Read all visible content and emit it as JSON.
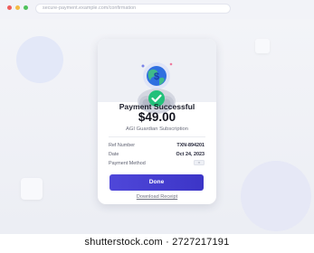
{
  "browser": {
    "url": "secure-payment.example.com/confirmation"
  },
  "receipt": {
    "title": "Payment Successful",
    "amount": "$49.00",
    "product": "AGI Guardian Subscription",
    "details": [
      {
        "label": "Ref Number",
        "value": "TXN-894201"
      },
      {
        "label": "Date",
        "value": "Oct 24, 2023"
      },
      {
        "label": "Payment Method",
        "value": ""
      }
    ],
    "done_label": "Done",
    "download_label": "Download Receipt"
  },
  "watermark": {
    "text": "shutterstock.com · 2727217191"
  },
  "colors": {
    "accent": "#4a43d6",
    "success": "#22c07a",
    "globe": "#2f6fe0"
  },
  "icons": {
    "success": "checkmark-badge-icon",
    "globe": "globe-dollar-icon",
    "payment_method": "card-icon"
  }
}
